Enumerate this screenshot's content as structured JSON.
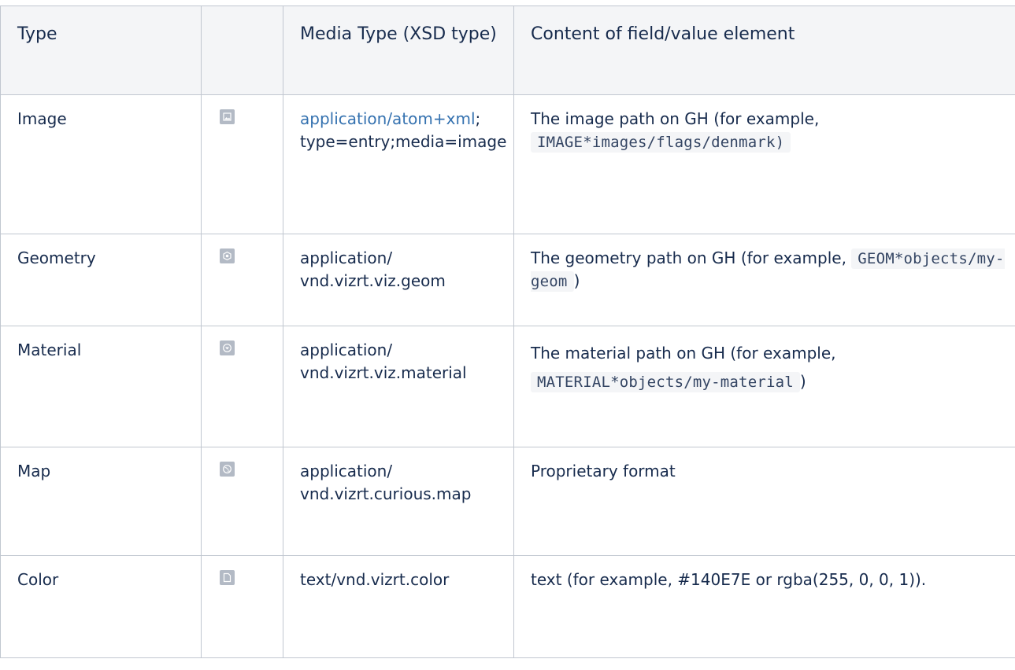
{
  "table": {
    "headers": {
      "type": "Type",
      "icon": "",
      "media_type": "Media Type (XSD type)",
      "content": "Content of field/value element"
    },
    "rows": [
      {
        "type": "Image",
        "icon": "image-icon",
        "media_type_link": "application/atom+xml",
        "media_type_rest": "; type=entry;media=image",
        "content_prefix": "The image path on GH (for example, ",
        "content_code": "IMAGE*images/flags/denmark)",
        "content_suffix": ""
      },
      {
        "type": "Geometry",
        "icon": "geometry-icon",
        "media_type": "application/ vnd.vizrt.viz.geom",
        "content_prefix": "The geometry path on GH (for example, ",
        "content_code": "GEOM*objects/my-geom",
        "content_suffix": ")"
      },
      {
        "type": "Material",
        "icon": "material-icon",
        "media_type": "application/ vnd.vizrt.viz.material",
        "content_prefix": "The material path on GH (for example, ",
        "content_code": "MATERIAL*objects/my-material",
        "content_suffix": ")"
      },
      {
        "type": "Map",
        "icon": "map-icon",
        "media_type": "application/ vnd.vizrt.curious.map",
        "content": "Proprietary format"
      },
      {
        "type": "Color",
        "icon": "document-icon",
        "media_type": "text/vnd.vizrt.color",
        "content": "text (for example, #140E7E or rgba(255, 0, 0, 1))."
      }
    ]
  },
  "colors": {
    "header_bg": "#f4f5f7",
    "border": "#c1c7d0",
    "text": "#172b4d",
    "link": "#3572b0",
    "code_bg": "#f4f5f7",
    "icon": "#b3bac5"
  }
}
